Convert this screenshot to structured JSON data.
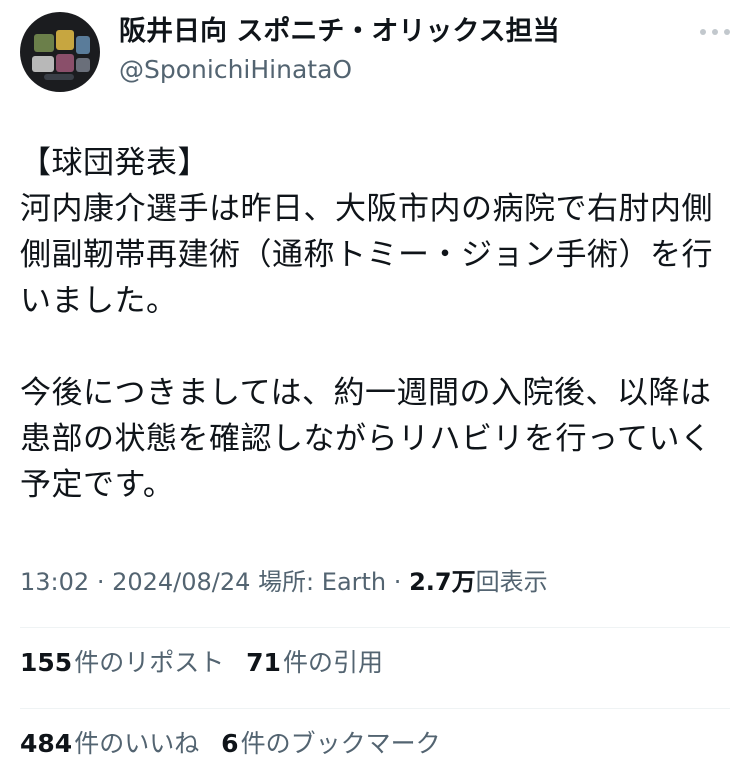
{
  "author": {
    "display_name": "阪井日向 スポニチ・オリックス担当",
    "handle": "@SponichiHinataO"
  },
  "tweet": {
    "paragraphs": [
      "【球団発表】\n河内康介選手は昨日、大阪市内の病院で右肘内側側副靭帯再建術（通称トミー・ジョン手術）を行いました。",
      "今後につきましては、約一週間の入院後、以降は患部の状態を確認しながらリハビリを行っていく予定です。"
    ]
  },
  "meta": {
    "time": "13:02",
    "separator": "·",
    "date": "2024/08/24",
    "location_label": "場所: Earth",
    "views_count": "2.7万",
    "views_label": "回表示"
  },
  "stats": {
    "reposts": {
      "count": "155",
      "label": "件のリポスト"
    },
    "quotes": {
      "count": "71",
      "label": "件の引用"
    },
    "likes": {
      "count": "484",
      "label": "件のいいね"
    },
    "bookmarks": {
      "count": "6",
      "label": "件のブックマーク"
    }
  },
  "icons": {
    "more": "more-horizontal-icon"
  },
  "colors": {
    "text_primary": "#0f1419",
    "text_secondary": "#536471",
    "divider": "#eff3f4",
    "avatar_bg": "#1b1c1f"
  }
}
